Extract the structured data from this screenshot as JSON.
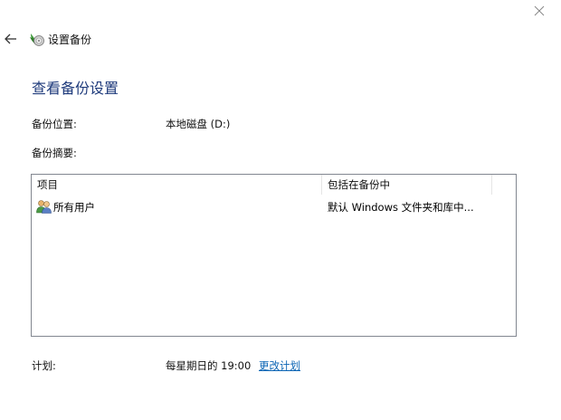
{
  "window": {
    "title": "设置备份"
  },
  "page": {
    "title": "查看备份设置"
  },
  "backup_location": {
    "label": "备份位置:",
    "value": "本地磁盘 (D:)"
  },
  "summary": {
    "label": "备份摘要:",
    "columns": [
      "项目",
      "包括在备份中"
    ],
    "rows": [
      {
        "icon": "users-icon",
        "name": "所有用户",
        "included": "默认 Windows 文件夹和库中..."
      }
    ]
  },
  "schedule": {
    "label": "计划:",
    "value": "每星期日的 19:00",
    "change_link": "更改计划"
  },
  "colors": {
    "title": "#1e3a7b",
    "link": "#0a64b4",
    "border": "#828790"
  }
}
